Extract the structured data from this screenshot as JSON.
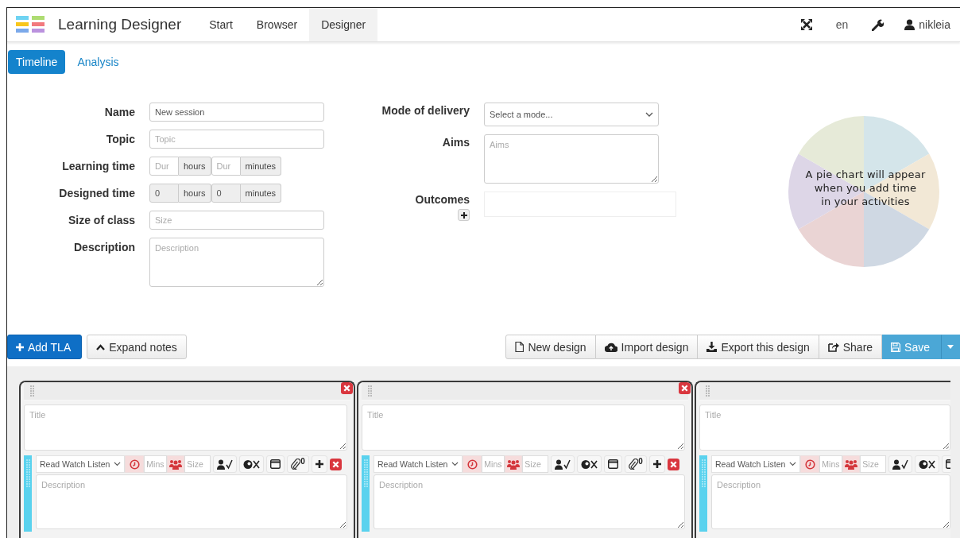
{
  "app": {
    "title": "Learning Designer",
    "nav": [
      {
        "label": "Start",
        "selected": false
      },
      {
        "label": "Browser",
        "selected": false
      },
      {
        "label": "Designer",
        "selected": true
      }
    ],
    "language": "en",
    "user": "nikleia"
  },
  "view_tabs": [
    {
      "label": "Timeline",
      "selected": true
    },
    {
      "label": "Analysis",
      "selected": false
    }
  ],
  "session_form": {
    "left": [
      {
        "label": "Name",
        "kind": "text",
        "value": "New session"
      },
      {
        "label": "Topic",
        "kind": "text",
        "placeholder": "Topic"
      },
      {
        "label": "Learning time",
        "kind": "duration",
        "disabled": false,
        "fields": [
          {
            "placeholder": "Dur",
            "unit": "hours"
          },
          {
            "placeholder": "Dur",
            "unit": "minutes"
          }
        ]
      },
      {
        "label": "Designed time",
        "kind": "duration",
        "disabled": true,
        "fields": [
          {
            "value": "0",
            "unit": "hours"
          },
          {
            "value": "0",
            "unit": "minutes"
          }
        ]
      },
      {
        "label": "Size of class",
        "kind": "text",
        "placeholder": "Size"
      },
      {
        "label": "Description",
        "kind": "textarea",
        "placeholder": "Description"
      }
    ],
    "right": [
      {
        "label": "Mode of delivery",
        "kind": "select",
        "value": "Select a mode..."
      },
      {
        "label": "Aims",
        "kind": "textarea",
        "placeholder": "Aims"
      },
      {
        "label": "Outcomes",
        "kind": "list"
      }
    ]
  },
  "pie_placeholder": {
    "message": "A pie chart will appear\nwhen you add time\nin your activities"
  },
  "toolbar": {
    "left": [
      {
        "label": "Add TLA",
        "kind": "primary"
      },
      {
        "label": "Expand notes",
        "kind": "default"
      }
    ],
    "right": [
      {
        "label": "New design",
        "kind": "default"
      },
      {
        "label": "Import design",
        "kind": "default"
      },
      {
        "label": "Export this design",
        "kind": "default"
      },
      {
        "label": "Share",
        "kind": "default"
      },
      {
        "label": "Save",
        "kind": "save"
      }
    ]
  },
  "tla_cards": [
    {
      "title_placeholder": "Title",
      "cut_off": false,
      "activity": {
        "type": "Read Watch Listen",
        "mins_placeholder": "Mins",
        "size_placeholder": "Size",
        "description_placeholder": "Description",
        "attachments": "0"
      }
    },
    {
      "title_placeholder": "Title",
      "cut_off": false,
      "activity": {
        "type": "Read Watch Listen",
        "mins_placeholder": "Mins",
        "size_placeholder": "Size",
        "description_placeholder": "Description",
        "attachments": "0"
      }
    },
    {
      "title_placeholder": "Title",
      "cut_off": true,
      "activity": {
        "type": "Read Watch Listen",
        "mins_placeholder": "Mins",
        "size_placeholder": "Size",
        "description_placeholder": "Description"
      }
    }
  ]
}
